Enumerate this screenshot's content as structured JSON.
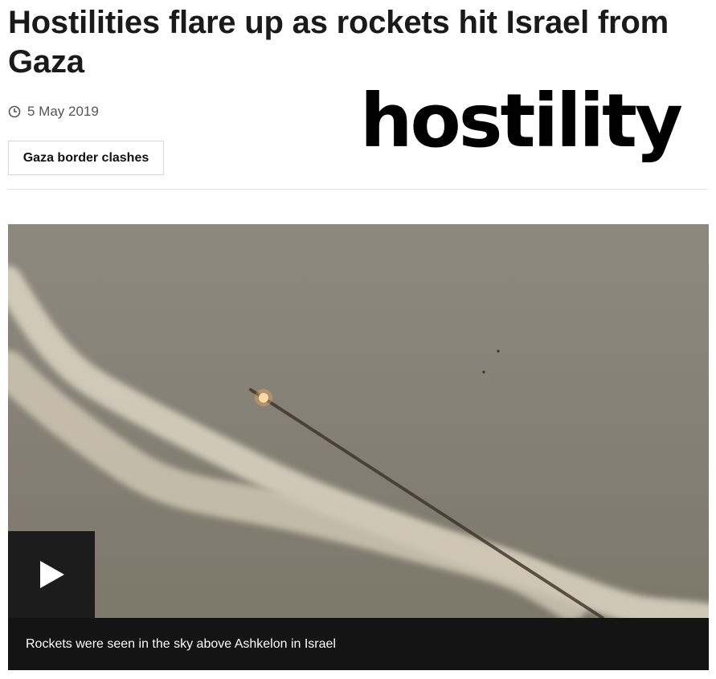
{
  "article": {
    "headline": "Hostilities flare up as rockets hit Israel from Gaza",
    "date": "5 May 2019",
    "tag_label": "Gaza border clashes"
  },
  "overlay": {
    "word": "hostility"
  },
  "media": {
    "caption": "Rockets were seen in the sky above Ashkelon in Israel",
    "play_icon": "play-icon",
    "sky_color": "#8e8a7f",
    "smoke_color": "#d9d2c4"
  },
  "icons": {
    "date_icon": "clock-icon"
  }
}
